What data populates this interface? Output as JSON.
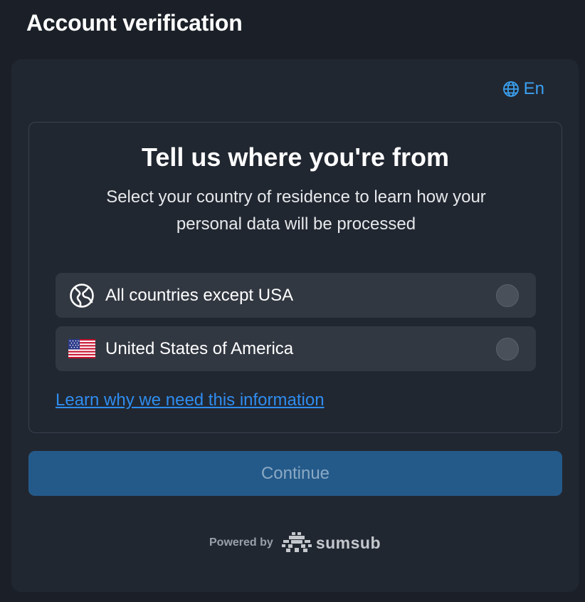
{
  "header": {
    "title": "Account verification"
  },
  "language": {
    "label": "En",
    "icon": "globe-icon"
  },
  "card": {
    "title": "Tell us where you're from",
    "subtitle": "Select your country of residence to learn how your personal data will be processed",
    "options": [
      {
        "label": "All countries except USA",
        "icon": "world-icon",
        "selected": false
      },
      {
        "label": "United States of America",
        "icon": "us-flag-icon",
        "selected": false
      }
    ],
    "learn_link": "Learn why we need this information"
  },
  "actions": {
    "continue_label": "Continue",
    "continue_enabled": false
  },
  "footer": {
    "powered_by": "Powered by",
    "brand": "sumsub"
  },
  "colors": {
    "background": "#1b2028",
    "panel": "#212731",
    "accent": "#3ba0f0",
    "link": "#2f8df0",
    "button": "#245a8a",
    "option_bg": "#323842"
  }
}
